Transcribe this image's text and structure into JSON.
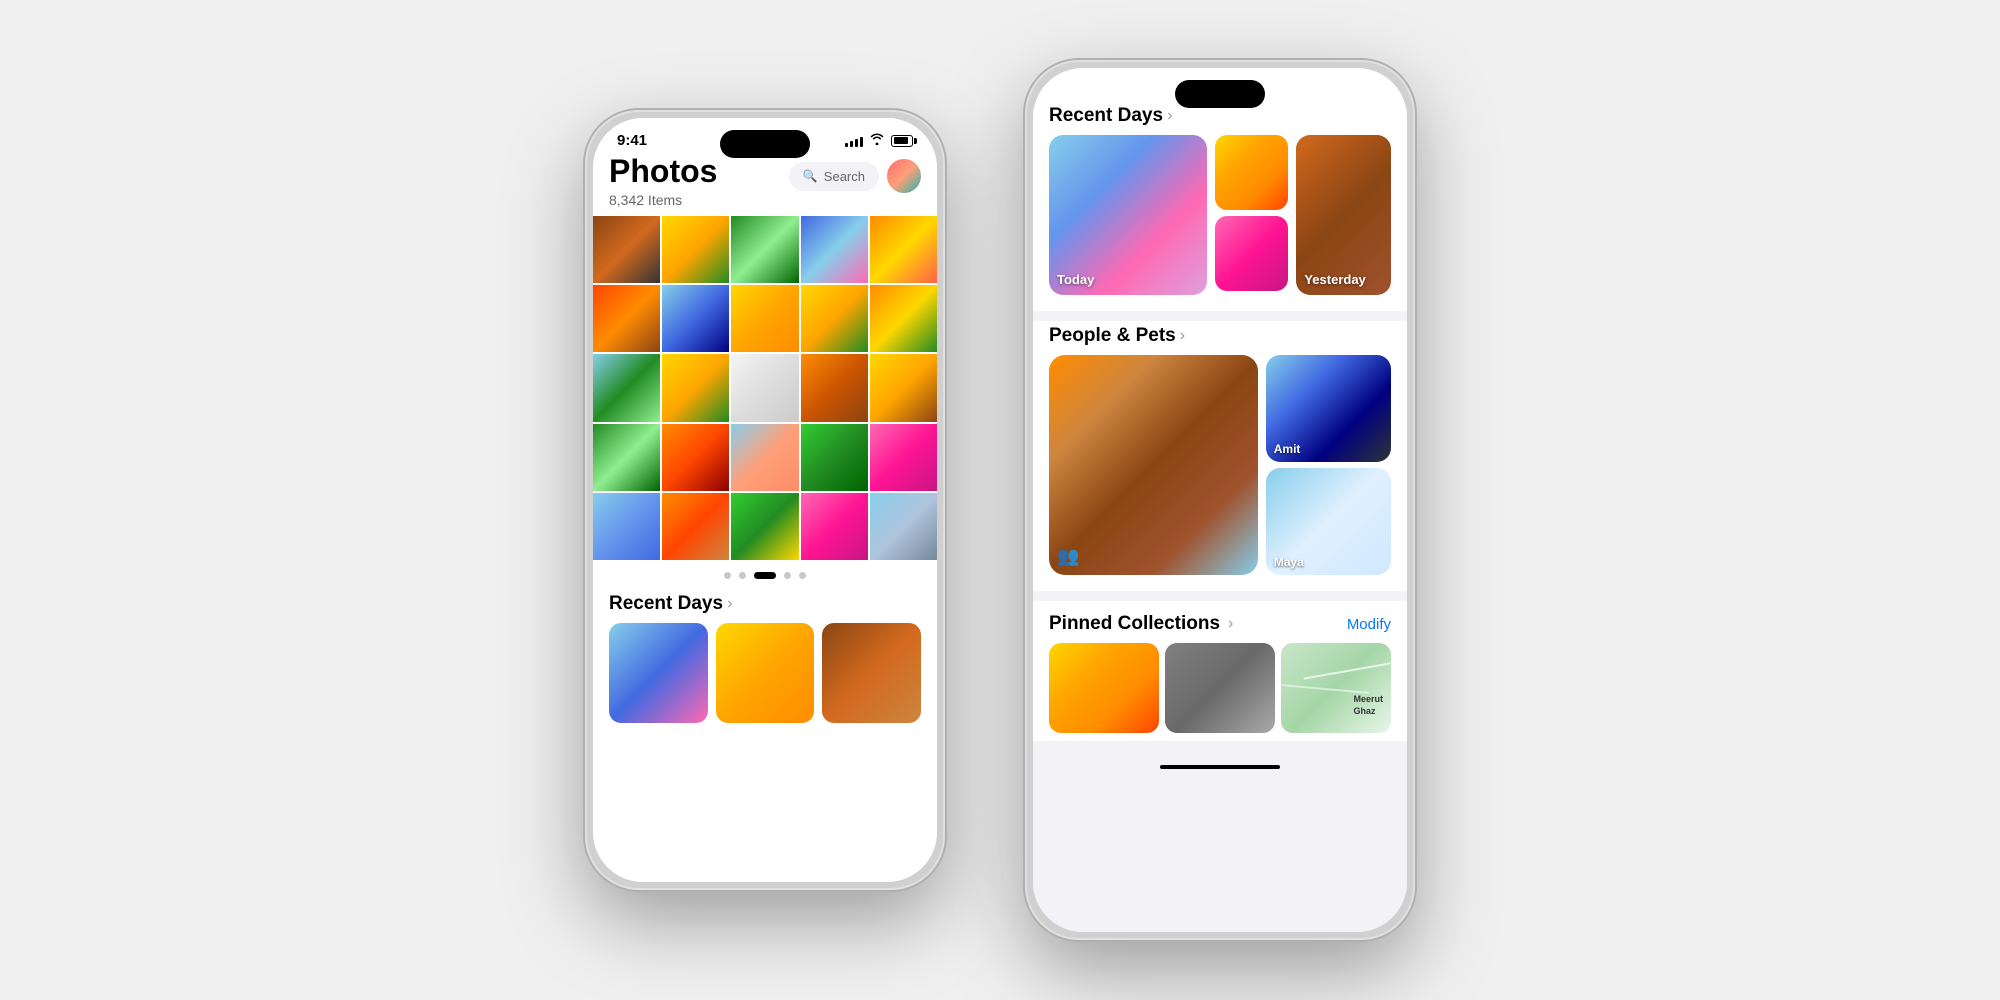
{
  "scene": {
    "bg_color": "#f0f0f0"
  },
  "phone1": {
    "status": {
      "time": "9:41",
      "signal_bars": [
        3,
        5,
        7,
        9,
        11
      ],
      "wifi": "wifi",
      "battery": 85
    },
    "header": {
      "title": "Photos",
      "count": "8,342 Items",
      "search_label": "Search"
    },
    "page_dots": [
      "dot",
      "dot",
      "active",
      "dot",
      "dot"
    ],
    "recent_days_label": "Recent Days",
    "chevron": "›"
  },
  "phone2": {
    "sections": {
      "recent_days": {
        "title": "Recent Days",
        "chevron": "›",
        "today_label": "Today",
        "yesterday_label": "Yesterday"
      },
      "people_pets": {
        "title": "People & Pets",
        "chevron": "›",
        "person1_name": "Amit",
        "person2_name": "Maya"
      },
      "pinned_collections": {
        "title": "Pinned Collections",
        "chevron": "›",
        "modify_label": "Modify"
      }
    },
    "scroll_indicator": true
  }
}
